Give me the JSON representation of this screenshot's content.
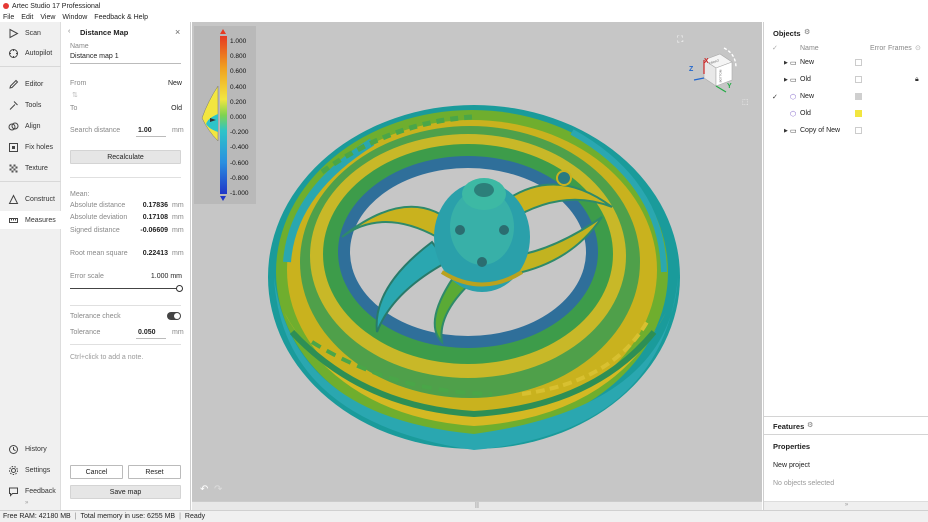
{
  "window": {
    "title": "Artec Studio 17 Professional"
  },
  "menu": [
    "File",
    "Edit",
    "View",
    "Window",
    "Feedback & Help"
  ],
  "nav": {
    "top": [
      {
        "label": "Scan",
        "icon": "play-icon"
      },
      {
        "label": "Autopilot",
        "icon": "autopilot-icon"
      }
    ],
    "middle": [
      {
        "label": "Editor",
        "icon": "pencil-icon"
      },
      {
        "label": "Tools",
        "icon": "tools-icon"
      },
      {
        "label": "Align",
        "icon": "align-icon"
      },
      {
        "label": "Fix holes",
        "icon": "fix-holes-icon"
      },
      {
        "label": "Texture",
        "icon": "texture-icon"
      }
    ],
    "lower": [
      {
        "label": "Construct",
        "icon": "construct-icon"
      },
      {
        "label": "Measures",
        "icon": "ruler-icon"
      }
    ],
    "bottom": [
      {
        "label": "History",
        "icon": "history-icon"
      },
      {
        "label": "Settings",
        "icon": "gear-icon"
      },
      {
        "label": "Feedback",
        "icon": "feedback-icon"
      }
    ]
  },
  "panel": {
    "title": "Distance Map",
    "back_icon": "chevron-left-icon",
    "close_icon": "close-icon",
    "name_label": "Name",
    "name_value": "Distance map 1",
    "from_label": "From",
    "from_value": "New",
    "swap_icon": "swap-icon",
    "to_label": "To",
    "to_value": "Old",
    "search_label": "Search distance",
    "search_value": "1.00",
    "search_unit": "mm",
    "recalc_label": "Recalculate",
    "mean_label": "Mean:",
    "abs_dist_label": "Absolute distance",
    "abs_dist_value": "0.17836",
    "abs_dist_unit": "mm",
    "abs_dev_label": "Absolute deviation",
    "abs_dev_value": "0.17108",
    "abs_dev_unit": "mm",
    "signed_label": "Signed distance",
    "signed_value": "-0.06609",
    "signed_unit": "mm",
    "rms_label": "Root mean square",
    "rms_value": "0.22413",
    "rms_unit": "mm",
    "error_scale_label": "Error scale",
    "error_scale_value": "1.000 mm",
    "error_scale_level": 1.0,
    "tolerance_check_label": "Tolerance check",
    "tolerance_check_on": true,
    "tolerance_label": "Tolerance",
    "tolerance_value": "0.050",
    "tolerance_unit": "mm",
    "note_placeholder": "Ctrl+click to add a note.",
    "cancel_label": "Cancel",
    "reset_label": "Reset",
    "save_label": "Save map"
  },
  "legend": {
    "ticks": [
      "1.000",
      "0.800",
      "0.600",
      "0.400",
      "0.200",
      "0.000",
      "-0.200",
      "-0.400",
      "-0.600",
      "-0.800",
      "-1.000"
    ]
  },
  "viewcube": {
    "axes": [
      "Z",
      "X",
      "Y"
    ],
    "faces": [
      "FRONT",
      "BOTTOM"
    ]
  },
  "viewport_icons": {
    "fit_icon": "fit-view-icon",
    "undo_icon": "undo-icon",
    "redo_icon": "redo-icon",
    "bottom_handle": "⠿"
  },
  "objects": {
    "title": "Objects",
    "settings_icon": "gear-icon",
    "col_name": "Name",
    "col_error": "Error",
    "col_frames": "Frames",
    "rows": [
      {
        "name": "New",
        "type": "folder",
        "expandable": true,
        "checked": false,
        "indent": 0,
        "color": "",
        "lock": false
      },
      {
        "name": "Old",
        "type": "folder",
        "expandable": true,
        "checked": false,
        "indent": 0,
        "color": "",
        "lock": true
      },
      {
        "name": "New",
        "type": "model",
        "expandable": false,
        "checked": true,
        "indent": 1,
        "color": "#cfcfcf",
        "lock": false
      },
      {
        "name": "Old",
        "type": "model",
        "expandable": false,
        "checked": false,
        "indent": 1,
        "color": "#f2e640",
        "lock": false
      },
      {
        "name": "Copy of New",
        "type": "folder",
        "expandable": true,
        "checked": false,
        "indent": 0,
        "color": "",
        "lock": false
      }
    ]
  },
  "features": {
    "title": "Features",
    "settings_icon": "gear-icon"
  },
  "properties": {
    "title": "Properties",
    "project": "New project",
    "empty": "No objects selected"
  },
  "status": {
    "ram": "Free RAM: 42180 MB",
    "memory": "Total memory in use: 6255 MB",
    "state": "Ready"
  }
}
